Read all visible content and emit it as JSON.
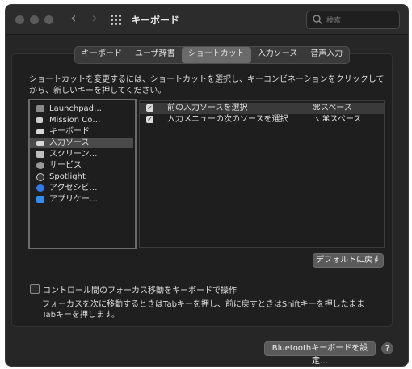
{
  "window": {
    "title": "キーボード",
    "search_placeholder": "検索",
    "nav_back": "‹",
    "nav_forward": "›"
  },
  "tabs": [
    {
      "label": "キーボード",
      "active": false
    },
    {
      "label": "ユーザ辞書",
      "active": false
    },
    {
      "label": "ショートカット",
      "active": true
    },
    {
      "label": "入力ソース",
      "active": false
    },
    {
      "label": "音声入力",
      "active": false
    }
  ],
  "description": "ショートカットを変更するには、ショートカットを選択し、キーコンビネーションをクリックしてから、新しいキーを押してください。",
  "categories": [
    {
      "label": "Launchpad…",
      "icon": "launchpad-icon",
      "selected": false
    },
    {
      "label": "Mission Co…",
      "icon": "mission-control-icon",
      "selected": false
    },
    {
      "label": "キーボード",
      "icon": "keyboard-icon",
      "selected": false
    },
    {
      "label": "入力ソース",
      "icon": "input-source-icon",
      "selected": true
    },
    {
      "label": "スクリーン…",
      "icon": "screenshot-icon",
      "selected": false
    },
    {
      "label": "サービス",
      "icon": "services-gear-icon",
      "selected": false
    },
    {
      "label": "Spotlight",
      "icon": "spotlight-icon",
      "selected": false
    },
    {
      "label": "アクセシビ…",
      "icon": "accessibility-icon",
      "selected": false
    },
    {
      "label": "アプリケー…",
      "icon": "app-store-icon",
      "selected": false
    }
  ],
  "shortcuts": [
    {
      "name": "前の入力ソースを選択",
      "key": "⌘スペース",
      "checked": true,
      "selected": true
    },
    {
      "name": "入力メニューの次のソースを選択",
      "key": "⌥⌘スペース",
      "checked": true,
      "selected": false
    }
  ],
  "defaults_button": "デフォルトに戻す",
  "focus_checkbox": {
    "label": "コントロール間のフォーカス移動をキーボードで操作",
    "checked": false,
    "note": "フォーカスを次に移動するときはTabキーを押し、前に戻すときはShiftキーを押したままTabキーを押します。"
  },
  "bluetooth_button": "Bluetoothキーボードを設定…",
  "help_button": "?",
  "colors": {
    "window_bg": "#262626",
    "panel_bg": "#1f1f1f",
    "selection": "#4a4a4a",
    "accent_blue": "#2f7ae5"
  }
}
